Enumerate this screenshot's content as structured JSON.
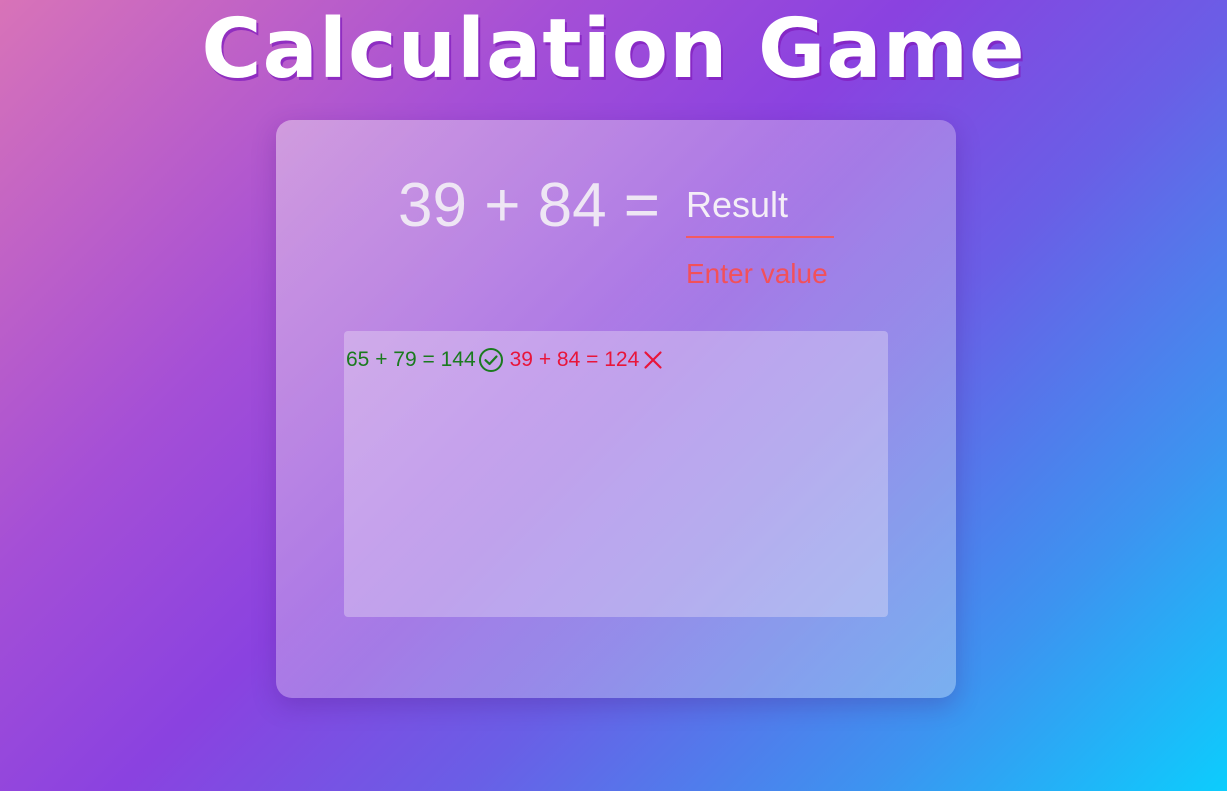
{
  "title": "Calculation Game",
  "question": {
    "equation": "39 + 84 =",
    "input_placeholder": "Result",
    "input_value": "",
    "error_message": "Enter value"
  },
  "history": [
    {
      "text": "65 + 79 = 144",
      "status": "correct",
      "icon": "check-circle-icon",
      "color": "#1a7a1e"
    },
    {
      "text": "39 + 84 = 124",
      "status": "wrong",
      "icon": "cross-icon",
      "color": "#e8153a"
    }
  ],
  "colors": {
    "error": "#f2505a",
    "correct": "#1a7a1e",
    "wrong": "#e8153a"
  }
}
